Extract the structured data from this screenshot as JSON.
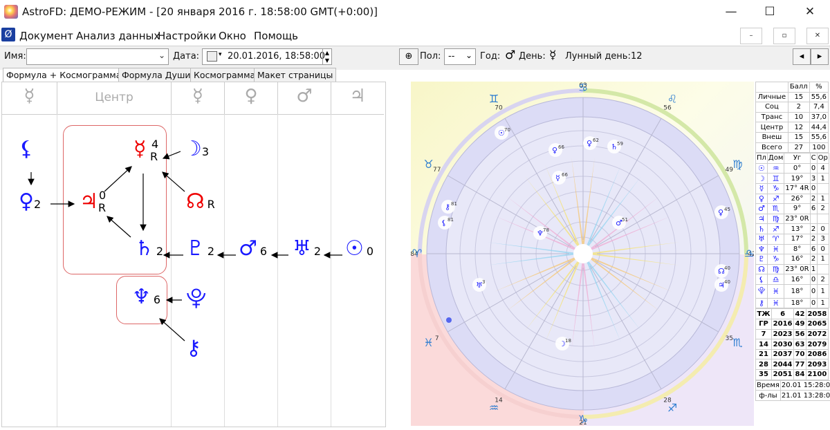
{
  "window": {
    "title": "AstroFD: ДЕМО-РЕЖИМ - [20 января 2016 г. 18:58:00 GMT(+0:00)]",
    "minimize": "—",
    "maximize": "☐",
    "close": "✕"
  },
  "menu": {
    "items": [
      "Документ",
      "Анализ данных",
      "Настройки",
      "Окно",
      "Помощь"
    ],
    "mdi": [
      "–",
      "▫",
      "✕"
    ]
  },
  "toolbar": {
    "name_label": "Имя:",
    "name_value": "",
    "date_label": "Дата:",
    "date_value": "20.01.2016, 18:58:00",
    "sex_label": "Пол:",
    "sex_value": "--",
    "year_label": "Год:",
    "year_glyph": "♂",
    "day_label": "День:",
    "day_glyph": "☿",
    "lunar_label": "Лунный день:",
    "lunar_value": "12",
    "prev": "◂",
    "next": "▸"
  },
  "tabs": [
    "Формула + Космограмма",
    "Формула Души",
    "Космограмма",
    "Макет страницы"
  ],
  "formula": {
    "headers": [
      "☿",
      "Центр",
      "☿",
      "♀",
      "♂",
      "♃"
    ],
    "nodes": [
      {
        "g": "⚸",
        "n": "",
        "c": "#1a1aff"
      },
      {
        "g": "♀",
        "n": "2",
        "c": "#1a1aff"
      },
      {
        "g": "♃",
        "n": "0",
        "r": "R",
        "c": "#e00"
      },
      {
        "g": "☿",
        "n": "4",
        "r": "R",
        "c": "#e00"
      },
      {
        "g": "☽",
        "n": "3",
        "c": "#1a1aff"
      },
      {
        "g": "☊",
        "n": "",
        "r": "R",
        "c": "#e00"
      },
      {
        "g": "♄",
        "n": "2",
        "c": "#1a1aff"
      },
      {
        "g": "♇",
        "n": "2",
        "c": "#1a1aff"
      },
      {
        "g": "♂",
        "n": "6",
        "c": "#1a1aff"
      },
      {
        "g": "♅",
        "n": "2",
        "c": "#1a1aff"
      },
      {
        "g": "☉",
        "n": "0",
        "c": "#1a1aff"
      },
      {
        "g": "♆",
        "n": "6",
        "c": "#1a1aff"
      },
      {
        "g": "⯓",
        "n": "",
        "c": "#1a1aff"
      },
      {
        "g": "⚷",
        "n": "",
        "c": "#1a1aff"
      }
    ]
  },
  "cosmogram": {
    "outer_numbers": [
      "63",
      "56",
      "49",
      "42",
      "35",
      "28",
      "21",
      "14",
      "7",
      "84",
      "77",
      "70"
    ],
    "zodiac": [
      "♈",
      "♉",
      "♊",
      "♋",
      "♌",
      "♍",
      "♎",
      "♏",
      "♐",
      "♑",
      "♒",
      "♓"
    ],
    "planets": [
      {
        "g": "☉",
        "v": "70"
      },
      {
        "g": "♀",
        "v": "62"
      },
      {
        "g": "♄",
        "v": "59"
      },
      {
        "g": "♀",
        "v": "66"
      },
      {
        "g": "☿",
        "v": "66"
      },
      {
        "g": "♂",
        "v": "51"
      },
      {
        "g": "♆",
        "v": "78"
      },
      {
        "g": "♅",
        "v": "3"
      },
      {
        "g": "☽",
        "v": "18"
      },
      {
        "g": "☊",
        "v": "40"
      },
      {
        "g": "♃",
        "v": "40"
      },
      {
        "g": "♀",
        "v": "45"
      },
      {
        "g": "⚷",
        "v": "81"
      },
      {
        "g": "⚸",
        "v": "81"
      }
    ]
  },
  "table": {
    "head": [
      "",
      "Балл",
      "%"
    ],
    "rows1": [
      [
        "Личные",
        "15",
        "55,6"
      ],
      [
        "Соц",
        "2",
        "7,4"
      ],
      [
        "Транс",
        "10",
        "37,0"
      ],
      [
        "Центр",
        "12",
        "44,4"
      ],
      [
        "Внеш",
        "15",
        "55,6"
      ],
      [
        "Всего",
        "27",
        "100"
      ]
    ],
    "head2": [
      "Пл",
      "Дом",
      "Уг",
      "С",
      "Ор"
    ],
    "rows2": [
      [
        "☉",
        "♒",
        "0°",
        "0",
        "4"
      ],
      [
        "☽",
        "♊",
        "19°",
        "3",
        "1"
      ],
      [
        "☿",
        "♑",
        "17° 4R",
        "0",
        ""
      ],
      [
        "♀",
        "♐",
        "26°",
        "2",
        "1"
      ],
      [
        "♂",
        "♏",
        "9°",
        "6",
        "2"
      ],
      [
        "♃",
        "♍",
        "23° 0R",
        "",
        ""
      ],
      [
        "♄",
        "♐",
        "13°",
        "2",
        "0"
      ],
      [
        "♅",
        "♈",
        "17°",
        "2",
        "3"
      ],
      [
        "♆",
        "♓",
        "8°",
        "6",
        "0"
      ],
      [
        "♇",
        "♑",
        "16°",
        "2",
        "1"
      ],
      [
        "☊",
        "♍",
        "23° 0R",
        "1",
        ""
      ],
      [
        "⚸",
        "♎",
        "16°",
        "0",
        "2"
      ],
      [
        "⯓",
        "♓",
        "18°",
        "0",
        "1"
      ],
      [
        "⚷",
        "♓",
        "18°",
        "0",
        "1"
      ]
    ],
    "rows3": [
      [
        "ТЖ",
        "6",
        "42",
        "2058"
      ],
      [
        "ГР",
        "2016",
        "49",
        "2065"
      ],
      [
        "7",
        "2023",
        "56",
        "2072"
      ],
      [
        "14",
        "2030",
        "63",
        "2079"
      ],
      [
        "21",
        "2037",
        "70",
        "2086"
      ],
      [
        "28",
        "2044",
        "77",
        "2093"
      ],
      [
        "35",
        "2051",
        "84",
        "2100"
      ]
    ],
    "time_label": "Время",
    "time_value": "20.01 15:28:00",
    "formula_label": "ф-лы",
    "formula_value": "21.01 13:28:00"
  },
  "colors": {
    "blue": "#1a1aff",
    "red": "#e00",
    "accent": "#cc4444"
  }
}
